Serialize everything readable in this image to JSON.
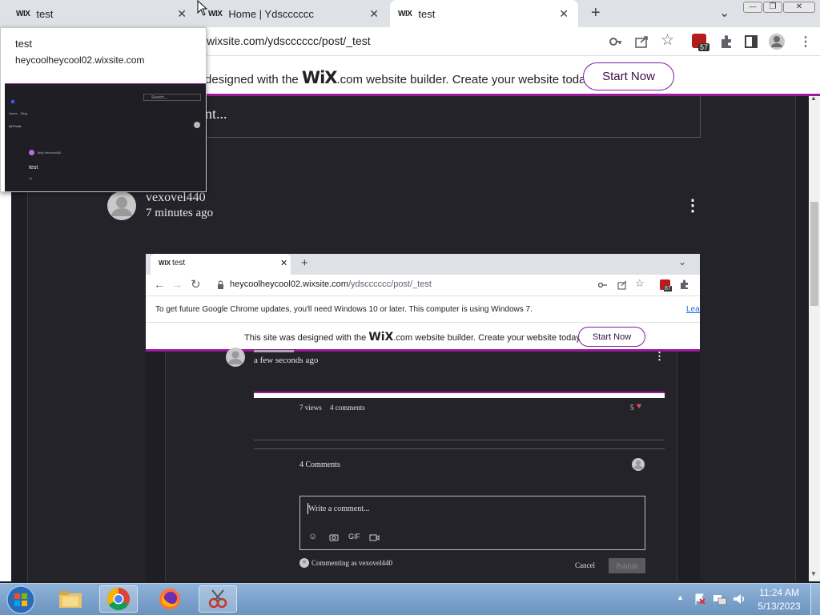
{
  "tabs": [
    {
      "wix": "WIX",
      "title": "test",
      "close": "✕"
    },
    {
      "wix": "WIX",
      "title": "Home | Ydscccccc",
      "close": "✕"
    },
    {
      "wix": "WIX",
      "title": "test",
      "close": "✕"
    }
  ],
  "new_tab": "+",
  "tab_menu": "⌄",
  "window_controls": {
    "minimize": "—",
    "maximize": "❐",
    "close": "✕"
  },
  "address": {
    "url": "wixsite.com/ydscccccc/post/_test"
  },
  "extension_badge": "57",
  "banner": {
    "prefix": "designed with the",
    "wix": "WiX",
    "suffix": ".com website builder. Create your website today.",
    "button": "Start Now"
  },
  "preview": {
    "title": "test",
    "url": "heycoolheycool02.wixsite.com",
    "search": "Search...",
    "nav_home": "Home",
    "nav_blog": "Blog",
    "all_posts": "All Posts",
    "author": "Tony Vexovel440",
    "post_title": "test",
    "post_sub": "Lk"
  },
  "partial_comment": "nt...",
  "post": {
    "author": "vexovel440",
    "time": "7 minutes ago",
    "more": "⋮"
  },
  "inner": {
    "tab_wix": "WIX",
    "tab_title": "test",
    "tab_close": "✕",
    "new_tab": "+",
    "chevron": "⌄",
    "url_domain": "heycoolheycool02.wixsite.com",
    "url_path": "/ydscccccc/post/_test",
    "badge": "87",
    "infobar": "To get future Google Chrome updates, you'll need Windows 10 or later. This computer is using Windows 7.",
    "learn": "Lear",
    "banner_prefix": "This site was designed with the",
    "banner_wix": "WiX",
    "banner_suffix": ".com website builder. Create your website today.",
    "banner_button": "Start Now",
    "post_time": "a few seconds ago",
    "views": "7 views",
    "comments": "4 comments",
    "likes": "5",
    "comments_header": "4 Comments",
    "write": "Write a comment...",
    "gif": "GIF",
    "commenting_as": "Commenting as vexovel440",
    "cancel": "Cancel",
    "publish": "Publish"
  },
  "clock": {
    "time": "11:24 AM",
    "date": "5/13/2023"
  },
  "colors": {
    "accent": "#9c1aa0",
    "page_bg": "#24232a",
    "heart": "#e8544a"
  }
}
